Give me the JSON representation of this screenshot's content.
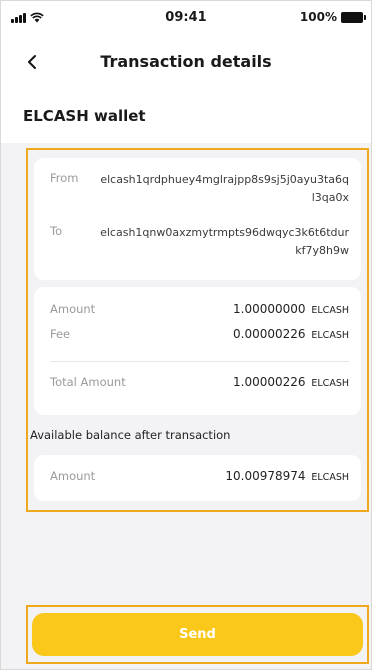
{
  "status_bar": {
    "time": "09:41",
    "battery": "100%"
  },
  "header": {
    "title": "Transaction details"
  },
  "wallet": {
    "title": "ELCASH wallet"
  },
  "addresses": {
    "from_label": "From",
    "from_value": "elcash1qrdphuey4mglrajpp8s9sj5j0ayu3ta6ql3qa0x",
    "to_label": "To",
    "to_value": "elcash1qnw0axzmytrmpts96dwqyc3k6t6tdurkf7y8h9w"
  },
  "amounts": {
    "amount_label": "Amount",
    "amount_value": "1.00000000",
    "fee_label": "Fee",
    "fee_value": "0.00000226",
    "total_label": "Total Amount",
    "total_value": "1.00000226",
    "unit": "ELCASH"
  },
  "balance": {
    "caption": "Available balance after transaction",
    "amount_label": "Amount",
    "amount_value": "10.00978974",
    "unit": "ELCASH"
  },
  "actions": {
    "send_label": "Send"
  },
  "colors": {
    "accent": "#f9c81a",
    "highlight_border": "#f0a81d",
    "background": "#f3f3f6"
  }
}
